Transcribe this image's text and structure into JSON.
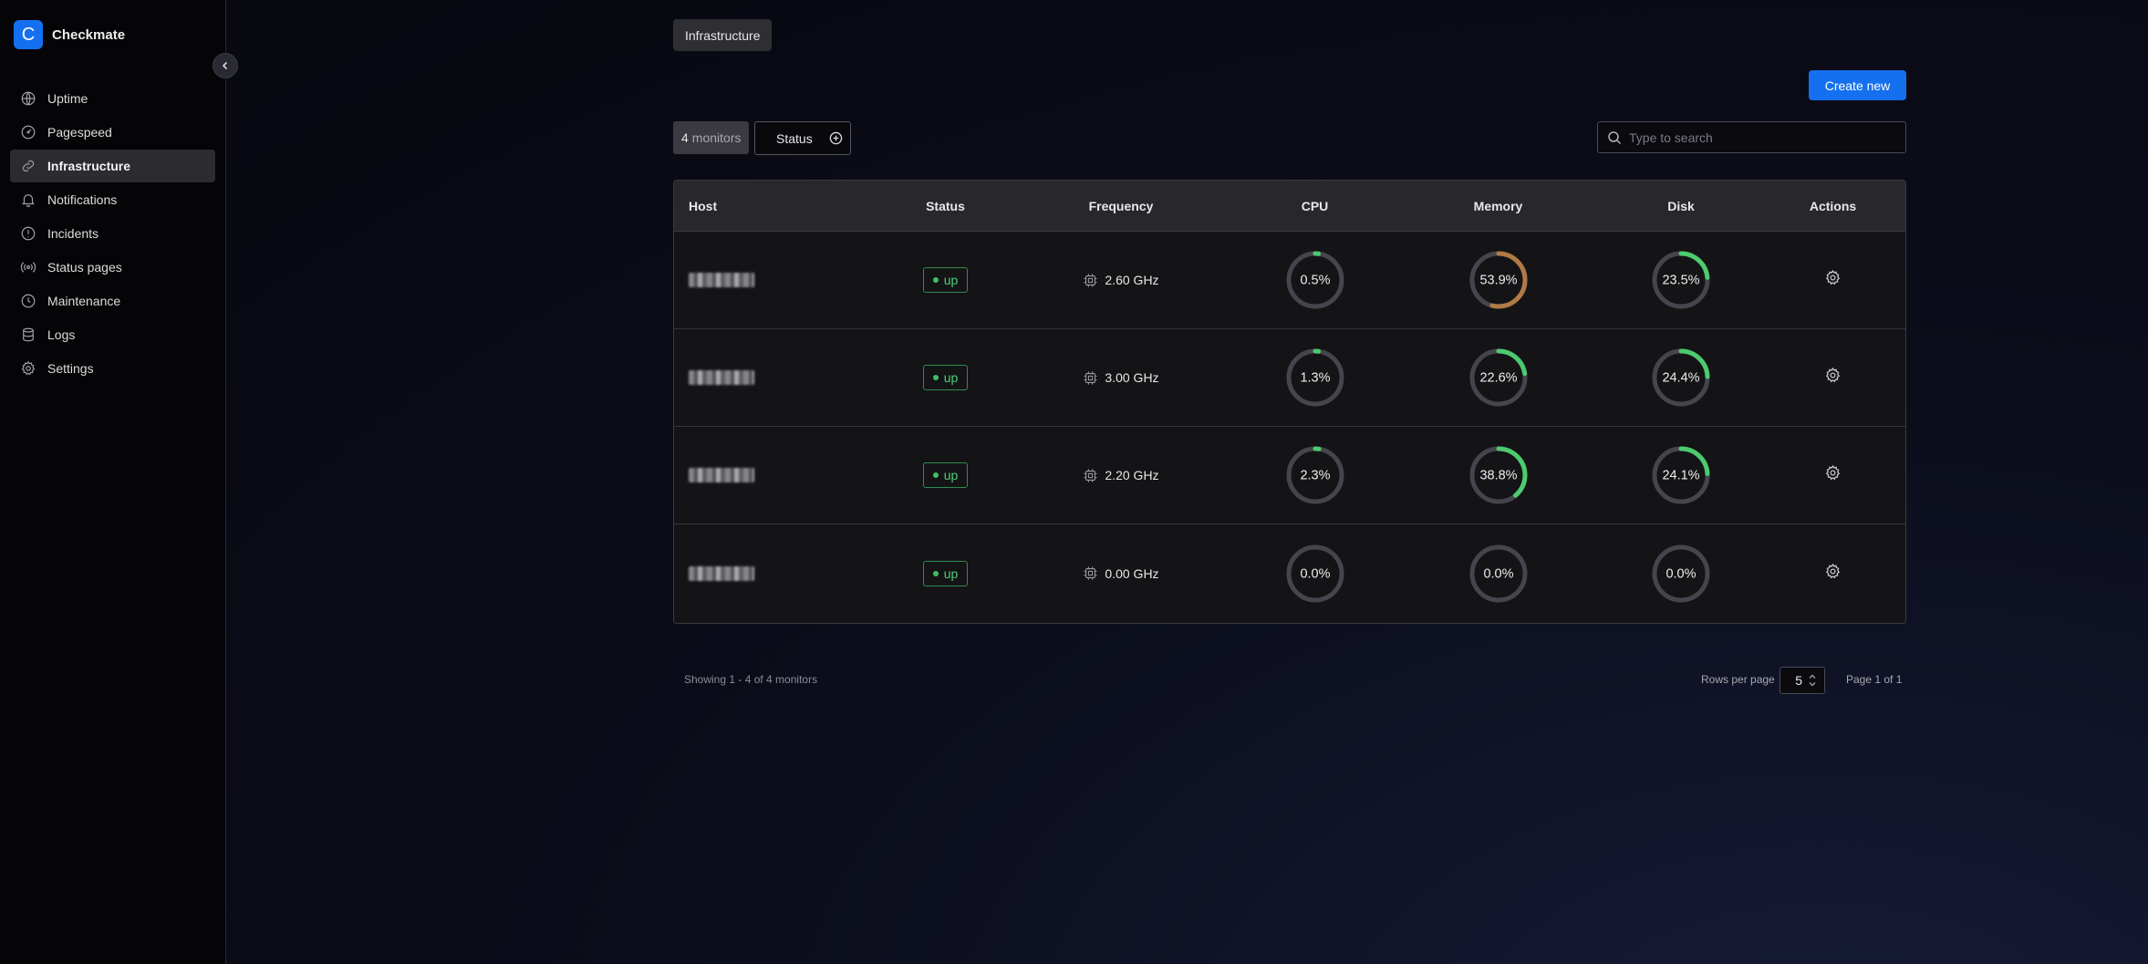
{
  "app": {
    "logo_letter": "C",
    "name": "Checkmate"
  },
  "sidebar": {
    "items": [
      {
        "label": "Uptime",
        "icon": "globe-icon",
        "active": false
      },
      {
        "label": "Pagespeed",
        "icon": "gauge-icon",
        "active": false
      },
      {
        "label": "Infrastructure",
        "icon": "link-icon",
        "active": true
      },
      {
        "label": "Notifications",
        "icon": "bell-icon",
        "active": false
      },
      {
        "label": "Incidents",
        "icon": "alert-circle-icon",
        "active": false
      },
      {
        "label": "Status pages",
        "icon": "broadcast-icon",
        "active": false
      },
      {
        "label": "Maintenance",
        "icon": "clock-icon",
        "active": false
      },
      {
        "label": "Logs",
        "icon": "database-icon",
        "active": false
      },
      {
        "label": "Settings",
        "icon": "gear-icon",
        "active": false
      }
    ]
  },
  "breadcrumb": "Infrastructure",
  "toolbar": {
    "create_label": "Create new",
    "monitor_count": "4",
    "monitor_count_suffix": "monitors",
    "status_filter_label": "Status",
    "search_placeholder": "Type to search"
  },
  "table": {
    "headers": {
      "host": "Host",
      "status": "Status",
      "frequency": "Frequency",
      "cpu": "CPU",
      "memory": "Memory",
      "disk": "Disk",
      "actions": "Actions"
    },
    "rows": [
      {
        "status": "up",
        "frequency": "2.60 GHz",
        "cpu": "0.5%",
        "memory": "53.9%",
        "disk": "23.5%"
      },
      {
        "status": "up",
        "frequency": "3.00 GHz",
        "cpu": "1.3%",
        "memory": "22.6%",
        "disk": "24.4%"
      },
      {
        "status": "up",
        "frequency": "2.20 GHz",
        "cpu": "2.3%",
        "memory": "38.8%",
        "disk": "24.1%"
      },
      {
        "status": "up",
        "frequency": "0.00 GHz",
        "cpu": "0.0%",
        "memory": "0.0%",
        "disk": "0.0%"
      }
    ]
  },
  "footer": {
    "showing": "Showing 1 - 4 of 4 monitors",
    "rows_per_page_label": "Rows per page",
    "rows_per_page_value": "5",
    "page_info": "Page 1 of 1"
  },
  "colors": {
    "accent": "#1570ef",
    "gauge_green": "#4ccb6e",
    "gauge_orange": "#b07a45",
    "gauge_track": "#45454d",
    "status_up": "#4fcf76"
  }
}
